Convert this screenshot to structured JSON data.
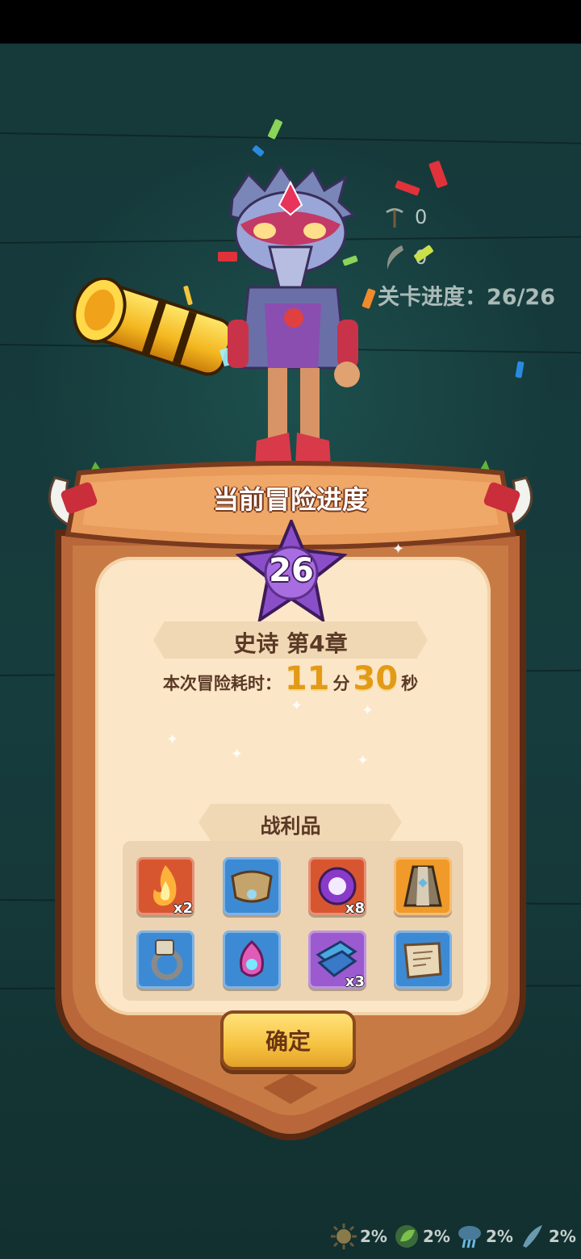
{
  "hud": {
    "pickaxe_count": "0",
    "horn_count": "0",
    "stage_progress": "关卡进度：26/26"
  },
  "dialog": {
    "title": "当前冒险进度",
    "level": "26",
    "chapter": "史诗 第4章",
    "time_label": "本次冒险耗时：",
    "minutes": "11",
    "minutes_unit": "分",
    "seconds": "30",
    "seconds_unit": "秒",
    "loot_title": "战利品",
    "confirm_label": "确定"
  },
  "loot": [
    {
      "icon": "flame-icon",
      "count": "x2",
      "frame": "#d8562f"
    },
    {
      "icon": "shoulder-armor-icon",
      "count": "",
      "frame": "#3d8ad4"
    },
    {
      "icon": "purple-orb-icon",
      "count": "x8",
      "frame": "#d8562f"
    },
    {
      "icon": "cloak-icon",
      "count": "",
      "frame": "#f09a2a"
    },
    {
      "icon": "ring-icon",
      "count": "",
      "frame": "#3d8ad4"
    },
    {
      "icon": "amulet-icon",
      "count": "",
      "frame": "#3d8ad4"
    },
    {
      "icon": "cloth-icon",
      "count": "x3",
      "frame": "#9b5ad0"
    },
    {
      "icon": "scroll-icon",
      "count": "",
      "frame": "#3d8ad4"
    }
  ],
  "bottom_stats": [
    {
      "icon": "sun-icon",
      "value": "2%"
    },
    {
      "icon": "leaf-icon",
      "value": "2%"
    },
    {
      "icon": "storm-icon",
      "value": "2%"
    },
    {
      "icon": "wind-icon",
      "value": "2%"
    }
  ],
  "colors": {
    "accent_gold": "#e29a17",
    "panel_cream": "#fbe6c7",
    "frame_brown": "#b8663a"
  }
}
